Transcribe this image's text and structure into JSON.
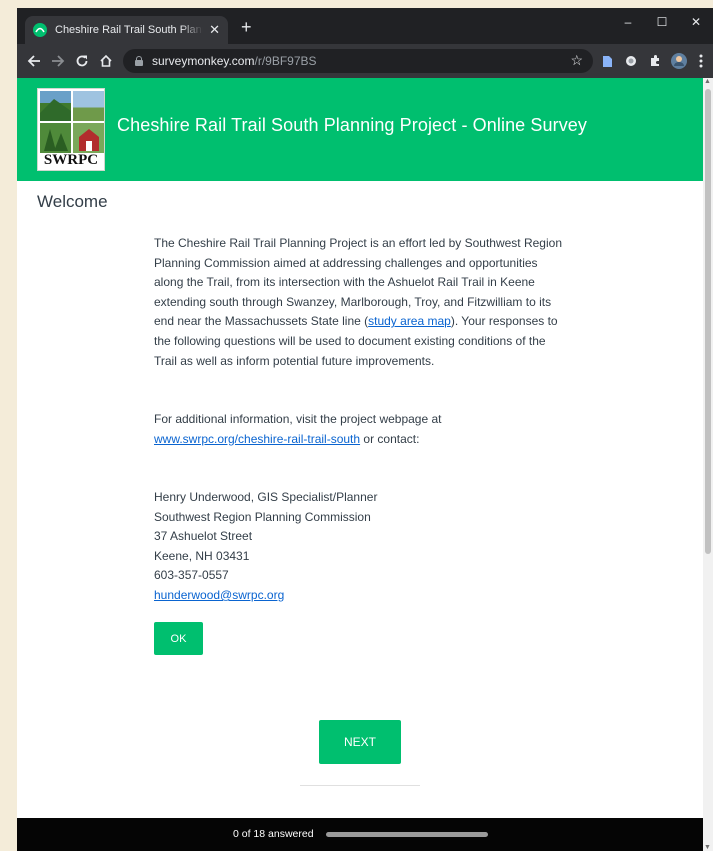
{
  "browser": {
    "tab_title": "Cheshire Rail Trail South Planning Project - Online Survey",
    "tab_close": "✕",
    "new_tab": "+",
    "window_controls": {
      "minimize": "–",
      "maximize": "☐",
      "close": "✕"
    },
    "url_host": "surveymonkey.com",
    "url_path": "/r/9BF97BS",
    "icons": [
      "back-icon",
      "forward-icon",
      "reload-icon",
      "home-icon",
      "lock-icon",
      "star-icon",
      "extension-icon",
      "menu-icon"
    ]
  },
  "banner": {
    "title": "Cheshire Rail Trail South Planning Project - Online Survey",
    "logo_text": "SWRPC"
  },
  "page": {
    "heading": "Welcome",
    "intro_before_link": "The Cheshire Rail Trail Planning Project is an effort led by Southwest Region Planning Commission aimed at addressing challenges and opportunities along the Trail, from its intersection with the Ashuelot Rail Trail in Keene extending south through Swanzey, Marlborough, Troy, and Fitzwilliam to its end near the Massachussets State line (",
    "intro_link": "study area map",
    "intro_after_link": "). Your responses to the following questions will be used to document existing conditions of the Trail as well as inform potential future improvements.",
    "info_text": "For additional information, visit the project webpage at",
    "info_link": "www.swrpc.org/cheshire-rail-trail-south",
    "info_after": " or contact:",
    "contact": {
      "name": "Henry Underwood, GIS Specialist/Planner",
      "org": "Southwest Region Planning Commission",
      "street": "37 Ashuelot Street",
      "city": "Keene, NH 03431",
      "phone": "603-357-0557",
      "email": "hunderwood@swrpc.org"
    },
    "ok_label": "OK",
    "next_label": "NEXT"
  },
  "progress": {
    "text": "0 of 18 answered",
    "answered": 0,
    "total": 18
  },
  "colors": {
    "brand_green": "#00bf6f",
    "link_blue": "#0a64d0",
    "text": "#333e48",
    "chrome_dark": "#202124",
    "chrome_toolbar": "#35363a"
  }
}
